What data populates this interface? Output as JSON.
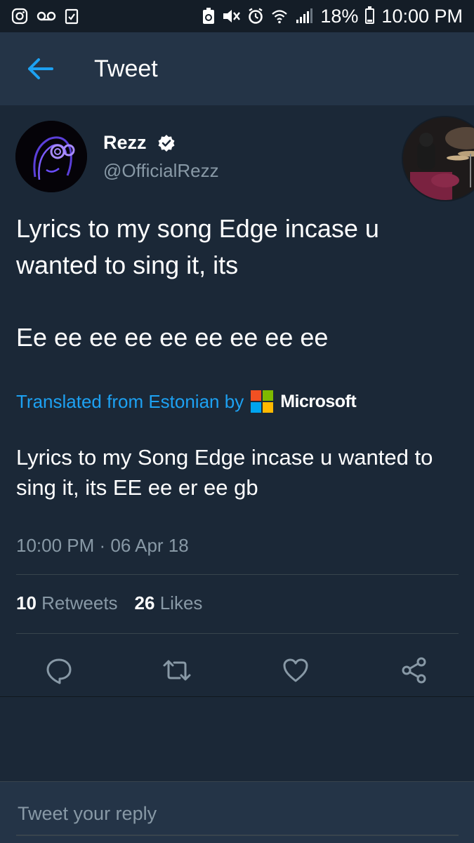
{
  "status_bar": {
    "battery_percent": "18%",
    "battery_level": 0.18,
    "time": "10:00 PM",
    "left_icons": [
      "instagram-icon",
      "voicemail-icon",
      "clipboard-check-icon"
    ],
    "right_icons": [
      "recycle-icon",
      "mute-icon",
      "alarm-icon",
      "wifi-icon",
      "signal-icon",
      "battery-icon"
    ]
  },
  "appbar": {
    "title": "Tweet",
    "back_icon": "back-arrow-icon",
    "accent": "#1da1f2"
  },
  "tweet": {
    "author": {
      "name": "Rezz ",
      "handle": "@OfficialRezz",
      "verified": true
    },
    "text_paragraphs": [
      "Lyrics to my song Edge incase u wanted to sing it, its",
      "Ee ee ee ee ee ee ee ee ee"
    ],
    "translation": {
      "label": "Translated from Estonian by",
      "provider": "Microsoft",
      "text": "Lyrics to my Song Edge incase u wanted to sing it, its EE ee er ee gb"
    },
    "timestamp": "10:00 PM · 06 Apr 18",
    "stats": {
      "retweets_count": "10",
      "retweets_label": "Retweets",
      "likes_count": "26",
      "likes_label": "Likes"
    },
    "actions": [
      "reply-icon",
      "retweet-icon",
      "like-icon",
      "share-icon"
    ]
  },
  "reply": {
    "placeholder": "Tweet your reply"
  },
  "colors": {
    "background": "#1b2837",
    "bar": "#243447",
    "muted_text": "#8899a6",
    "link": "#1da1f2",
    "divider": "#38444d"
  }
}
